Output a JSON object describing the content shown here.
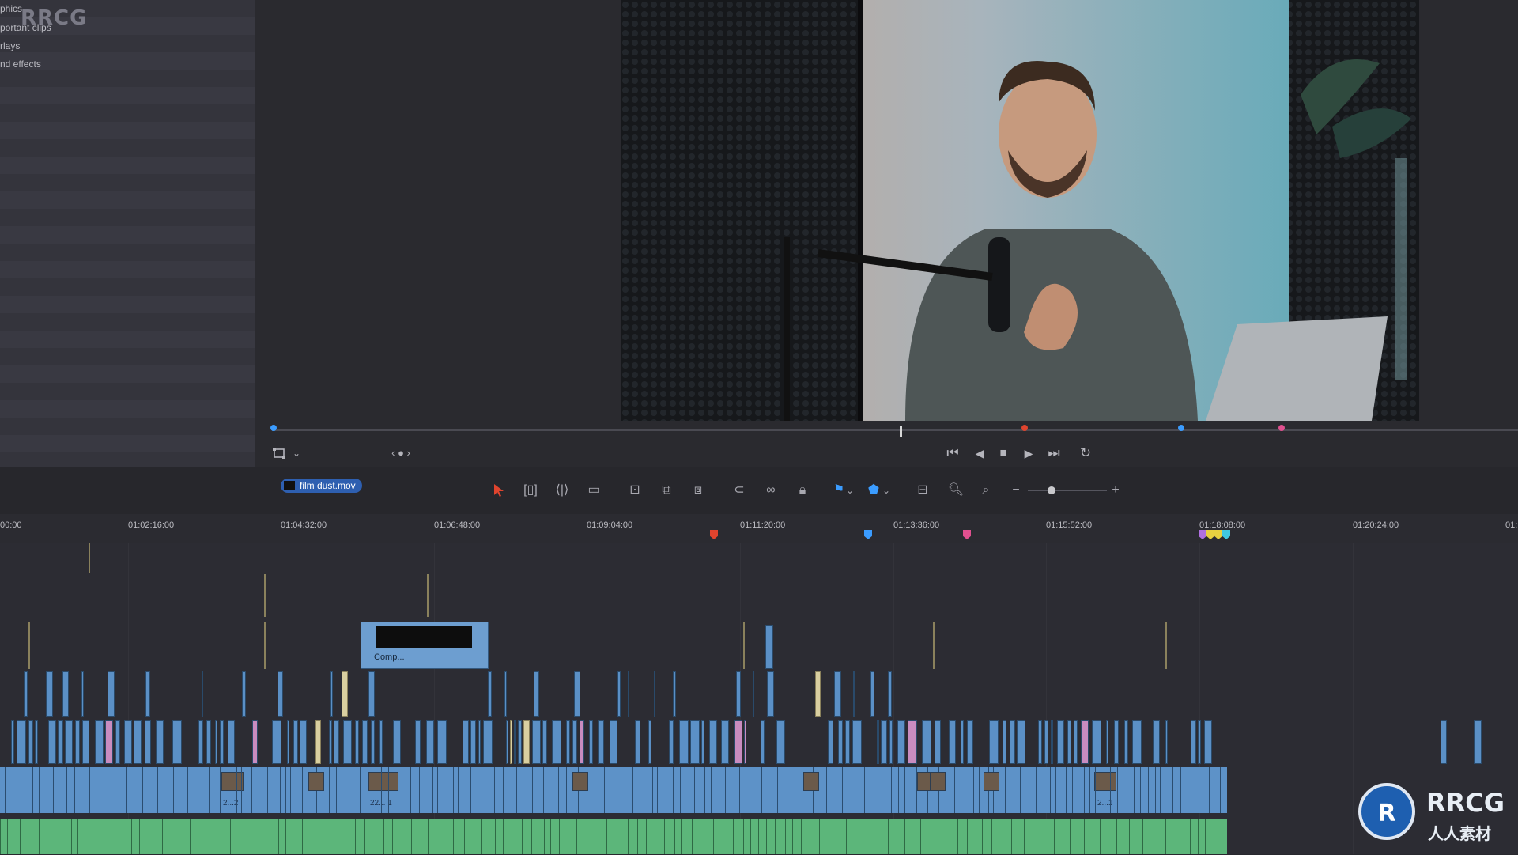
{
  "left_panel": {
    "brand": "RRCG",
    "items": [
      {
        "label": "phics"
      },
      {
        "label": "portant clips"
      },
      {
        "label": "rlays"
      },
      {
        "label": "nd effects"
      }
    ]
  },
  "viewer": {
    "nav_label": "‹ ● ›",
    "transport": {
      "first": "⏮",
      "prev": "◀",
      "stop": "■",
      "play": "▶",
      "last": "⏭",
      "loop": "↻"
    },
    "markers": [
      {
        "color": "#3b9cff"
      },
      {
        "color": "#e0442e"
      },
      {
        "color": "#3b9cff"
      },
      {
        "color": "#e0508f"
      }
    ]
  },
  "toolbar": {
    "clip_name": "film dust.mov",
    "zoom_minus": "−",
    "zoom_plus": "+"
  },
  "ruler": {
    "timecodes": [
      "00:00",
      "01:02:16:00",
      "01:04:32:00",
      "01:06:48:00",
      "01:09:04:00",
      "01:11:20:00",
      "01:13:36:00",
      "01:15:52:00",
      "01:18:08:00",
      "01:20:24:00",
      "01:"
    ],
    "marker_colors": {
      "red": "#e0442e",
      "blue": "#3b9cff",
      "pink": "#e0508f",
      "purple": "#b070e0",
      "yellow": "#e8d040",
      "cyan": "#40c8e0"
    }
  },
  "timeline": {
    "compound_label": "Comp...",
    "thumb_labels": [
      "2...2",
      "22... 1",
      "2...1"
    ],
    "colors": {
      "video": "#5d92c8",
      "audio": "#5cb67a"
    }
  },
  "logo": {
    "title": "RRCG",
    "subtitle": "人人素材"
  }
}
